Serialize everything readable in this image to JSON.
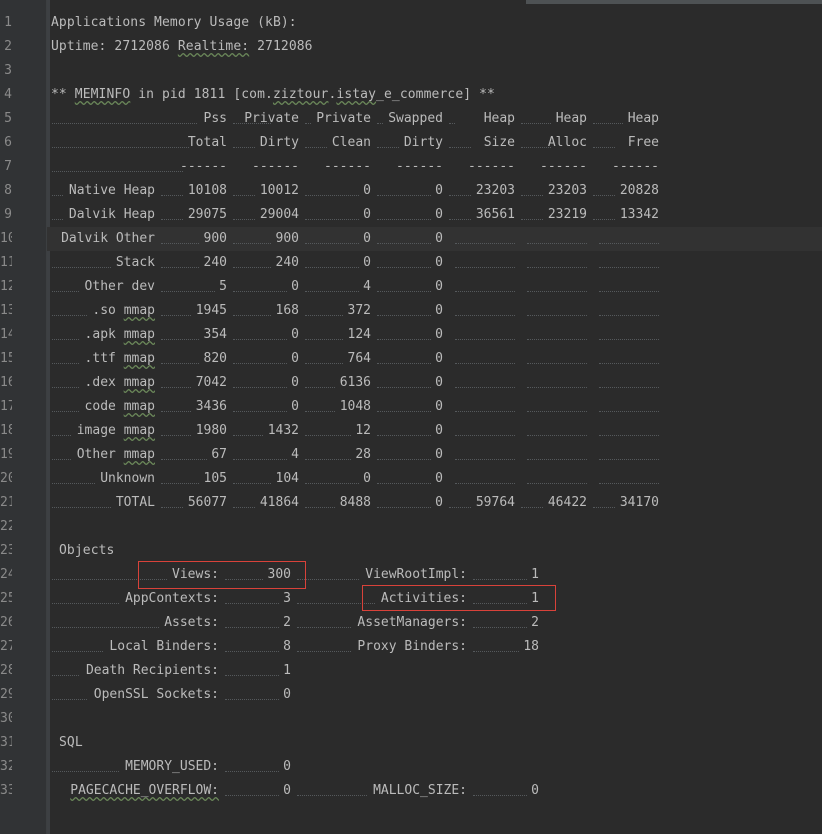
{
  "gutter": {
    "line_numbers": [
      "1",
      "2",
      "3",
      "4",
      "5",
      "6",
      "7",
      "8",
      "9",
      "10",
      "11",
      "12",
      "13",
      "14",
      "15",
      "16",
      "17",
      "18",
      "19",
      "20",
      "21",
      "22",
      "23",
      "24",
      "25",
      "26",
      "27",
      "28",
      "29",
      "30",
      "31",
      "32",
      "33"
    ]
  },
  "header": {
    "line1": "Applications Memory Usage (kB):",
    "uptime_label": "Uptime:",
    "uptime_value": "2712086",
    "realtime_label": "Realtime:",
    "realtime_value": "2712086",
    "meminfo_prefix": "** ",
    "meminfo_word": "MEMINFO",
    "meminfo_mid": " in pid 1811 [com.",
    "meminfo_pkg_word": "ziztour",
    "meminfo_mid2": ".",
    "meminfo_pkg_word2": "istay",
    "meminfo_suffix": "_e_commerce] **"
  },
  "table": {
    "head1": [
      "Pss",
      "Private",
      "Private",
      "Swapped",
      "Heap",
      "Heap",
      "Heap"
    ],
    "head2": [
      "Total",
      "Dirty",
      "Clean",
      "Dirty",
      "Size",
      "Alloc",
      "Free"
    ],
    "separator": "------",
    "rows": [
      {
        "label": "Native Heap",
        "label_parts": [
          "Native Heap",
          ""
        ],
        "values": [
          "10108",
          "10012",
          "0",
          "0",
          "23203",
          "23203",
          "20828"
        ]
      },
      {
        "label": "Dalvik Heap",
        "label_parts": [
          "Dalvik Heap",
          ""
        ],
        "values": [
          "29075",
          "29004",
          "0",
          "0",
          "36561",
          "23219",
          "13342"
        ]
      },
      {
        "label": "Dalvik Other",
        "label_parts": [
          "Dalvik Other",
          ""
        ],
        "values": [
          "900",
          "900",
          "0",
          "0",
          "",
          "",
          ""
        ]
      },
      {
        "label": "Stack",
        "label_parts": [
          "Stack",
          ""
        ],
        "values": [
          "240",
          "240",
          "0",
          "0",
          "",
          "",
          ""
        ]
      },
      {
        "label": "Other dev",
        "label_parts": [
          "Other dev",
          ""
        ],
        "values": [
          "5",
          "0",
          "4",
          "0",
          "",
          "",
          ""
        ]
      },
      {
        "label": ".so mmap",
        "label_parts": [
          ".so ",
          "mmap"
        ],
        "values": [
          "1945",
          "168",
          "372",
          "0",
          "",
          "",
          ""
        ]
      },
      {
        "label": ".apk mmap",
        "label_parts": [
          ".apk ",
          "mmap"
        ],
        "values": [
          "354",
          "0",
          "124",
          "0",
          "",
          "",
          ""
        ]
      },
      {
        "label": ".ttf mmap",
        "label_parts": [
          ".ttf ",
          "mmap"
        ],
        "values": [
          "820",
          "0",
          "764",
          "0",
          "",
          "",
          ""
        ]
      },
      {
        "label": ".dex mmap",
        "label_parts": [
          ".dex ",
          "mmap"
        ],
        "values": [
          "7042",
          "0",
          "6136",
          "0",
          "",
          "",
          ""
        ]
      },
      {
        "label": "code mmap",
        "label_parts": [
          "code ",
          "mmap"
        ],
        "values": [
          "3436",
          "0",
          "1048",
          "0",
          "",
          "",
          ""
        ]
      },
      {
        "label": "image mmap",
        "label_parts": [
          "image ",
          "mmap"
        ],
        "values": [
          "1980",
          "1432",
          "12",
          "0",
          "",
          "",
          ""
        ]
      },
      {
        "label": "Other mmap",
        "label_parts": [
          "Other ",
          "mmap"
        ],
        "values": [
          "67",
          "4",
          "28",
          "0",
          "",
          "",
          ""
        ]
      },
      {
        "label": "Unknown",
        "label_parts": [
          "Unknown",
          ""
        ],
        "values": [
          "105",
          "104",
          "0",
          "0",
          "",
          "",
          ""
        ]
      },
      {
        "label": "TOTAL",
        "label_parts": [
          "TOTAL",
          ""
        ],
        "values": [
          "56077",
          "41864",
          "8488",
          "0",
          "59764",
          "46422",
          "34170"
        ]
      }
    ]
  },
  "objects": {
    "title": "Objects",
    "left": [
      {
        "label": "Views:",
        "value": "300"
      },
      {
        "label": "AppContexts:",
        "value": "3"
      },
      {
        "label": "Assets:",
        "value": "2"
      },
      {
        "label": "Local Binders:",
        "value": "8"
      },
      {
        "label": "Death Recipients:",
        "value": "1"
      },
      {
        "label": "OpenSSL Sockets:",
        "value": "0"
      }
    ],
    "right": [
      {
        "label": "ViewRootImpl:",
        "value": "1"
      },
      {
        "label": "Activities:",
        "value": "1"
      },
      {
        "label": "AssetManagers:",
        "value": "2"
      },
      {
        "label": "Proxy Binders:",
        "value": "18"
      }
    ]
  },
  "sql": {
    "title": "SQL",
    "memory_used_label": "MEMORY_USED:",
    "memory_used_value": "0",
    "pagecache_label": "PAGECACHE_OVERFLOW:",
    "pagecache_value": "0",
    "malloc_label": "MALLOC_SIZE:",
    "malloc_value": "0"
  },
  "colors": {
    "background": "#2b2b2b",
    "gutter": "#313335",
    "text": "#bbbbbb",
    "highlight_box": "#d9423a"
  }
}
